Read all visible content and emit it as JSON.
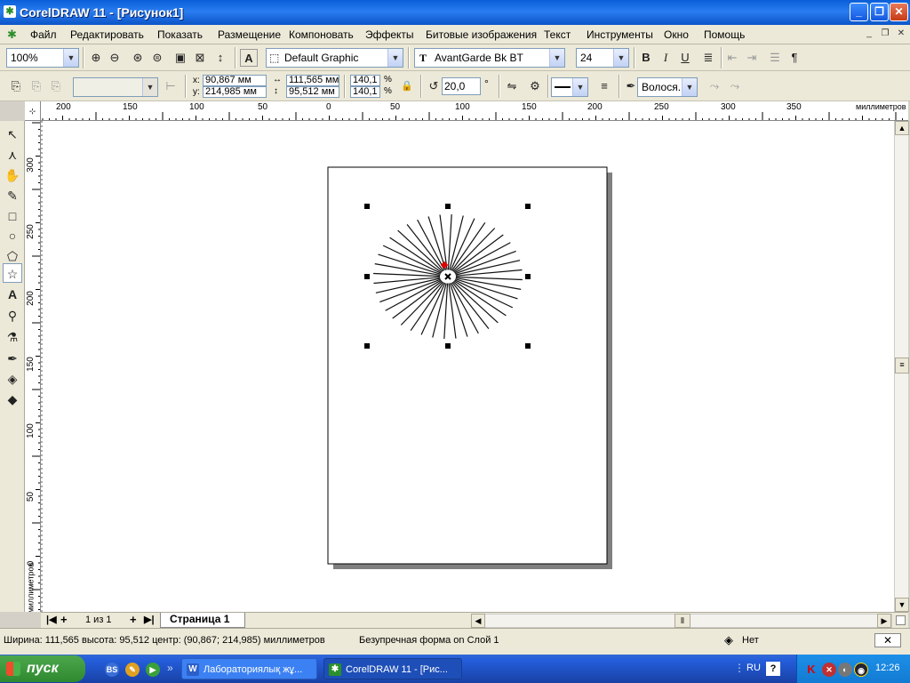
{
  "window": {
    "title": "CorelDRAW 11 - [Рисунок1]"
  },
  "menu": {
    "items": [
      "Файл",
      "Редактировать",
      "Показать",
      "Размещение",
      "Компоновать",
      "Эффекты",
      "Битовые изображения",
      "Текст",
      "Инструменты",
      "Окно",
      "Помощь"
    ]
  },
  "toolbar1": {
    "zoom": "100%",
    "style": "Default Graphic",
    "font": "AvantGarde Bk BT",
    "font_size": "24"
  },
  "toolbar2": {
    "x_label": "x:",
    "x_value": "90,867 мм",
    "y_label": "y:",
    "y_value": "214,985 мм",
    "width_value": "111,565 мм",
    "height_value": "95,512 мм",
    "scale_x": "140,1",
    "scale_y": "140,1",
    "percent": "%",
    "angle": "20,0",
    "degree": "°",
    "outline": "Волося..."
  },
  "rulers": {
    "h_ticks": [
      "200",
      "150",
      "100",
      "50",
      "0",
      "50",
      "100",
      "150",
      "200",
      "250",
      "300",
      "350"
    ],
    "h_unit": "миллиметров",
    "v_ticks": [
      "300",
      "250",
      "200",
      "150",
      "100",
      "50",
      "0"
    ],
    "v_unit": "миллиметров"
  },
  "pages": {
    "counter": "1 из 1",
    "tab": "Страница 1"
  },
  "status": {
    "dims": "Ширина: 111,565  высота: 95,512  центр: (90,867; 214,985)  миллиметров",
    "object": "Безупречная форма on Слой 1",
    "fill": "Нет"
  },
  "taskbar": {
    "start": "пуск",
    "tasks": [
      "Лабораториялық жұ...",
      "CorelDRAW 11 - [Рис..."
    ],
    "lang": "RU",
    "time": "12:26"
  },
  "star": {
    "rays": 40,
    "selected_node": "red",
    "colors": {
      "accent": "#0a5fd8",
      "node": "#e00000"
    }
  }
}
